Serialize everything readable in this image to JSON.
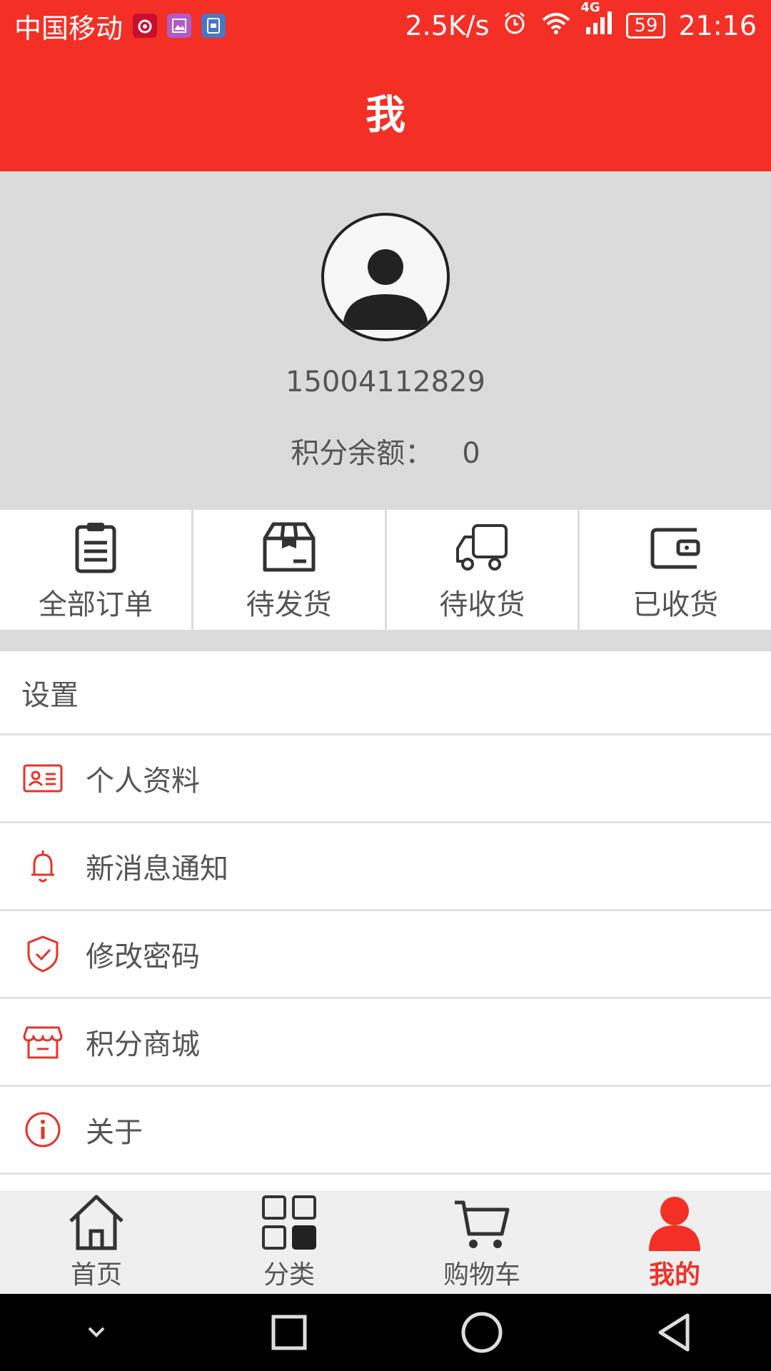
{
  "status_bar": {
    "carrier": "中国移动",
    "net_speed": "2.5K/s",
    "network_type": "4G",
    "battery": "59",
    "time": "21:16"
  },
  "app_bar": {
    "title": "我"
  },
  "profile": {
    "phone": "15004112829",
    "points_label": "积分余额：",
    "points_value": "0"
  },
  "orders": [
    {
      "label": "全部订单",
      "icon": "clipboard-icon"
    },
    {
      "label": "待发货",
      "icon": "package-icon"
    },
    {
      "label": "待收货",
      "icon": "truck-icon"
    },
    {
      "label": "已收货",
      "icon": "wallet-icon"
    }
  ],
  "menu": {
    "header": "设置",
    "items": [
      {
        "label": "个人资料",
        "icon": "id-card-icon"
      },
      {
        "label": "新消息通知",
        "icon": "bell-icon"
      },
      {
        "label": "修改密码",
        "icon": "shield-check-icon"
      },
      {
        "label": "积分商城",
        "icon": "store-icon"
      },
      {
        "label": "关于",
        "icon": "info-icon"
      }
    ]
  },
  "bottom_nav": [
    {
      "label": "首页",
      "icon": "home-icon"
    },
    {
      "label": "分类",
      "icon": "grid-icon"
    },
    {
      "label": "购物车",
      "icon": "cart-icon"
    },
    {
      "label": "我的",
      "icon": "user-icon",
      "active": true
    }
  ],
  "colors": {
    "accent": "#f42f25",
    "header_bg": "#dcdbdc",
    "text": "#555555"
  }
}
